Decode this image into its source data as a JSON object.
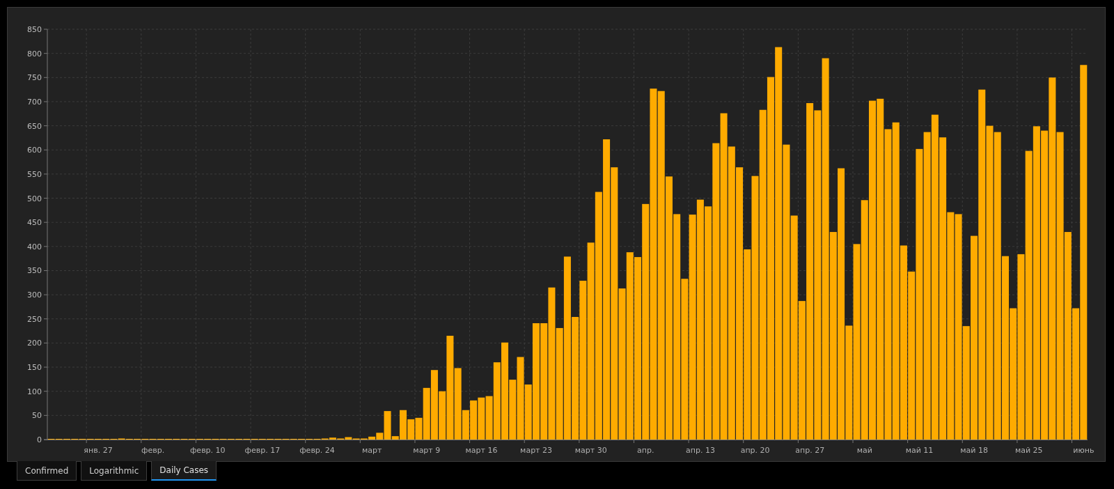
{
  "chart": {
    "chart_data": {
      "type": "bar",
      "categories": [
        null,
        null,
        null,
        null,
        null,
        null,
        "янв. 27",
        null,
        null,
        null,
        null,
        null,
        null,
        "февр.",
        null,
        null,
        null,
        null,
        null,
        null,
        "февр. 10",
        null,
        null,
        null,
        null,
        null,
        null,
        "февр. 17",
        null,
        null,
        null,
        null,
        null,
        null,
        "февр. 24",
        null,
        null,
        null,
        null,
        null,
        null,
        "март",
        null,
        null,
        null,
        null,
        null,
        null,
        "март 9",
        null,
        null,
        null,
        null,
        null,
        null,
        "март 16",
        null,
        null,
        null,
        null,
        null,
        null,
        "март 23",
        null,
        null,
        null,
        null,
        null,
        null,
        "март 30",
        null,
        null,
        null,
        null,
        null,
        null,
        "апр.",
        null,
        null,
        null,
        null,
        null,
        null,
        "апр. 13",
        null,
        null,
        null,
        null,
        null,
        null,
        "апр. 20",
        null,
        null,
        null,
        null,
        null,
        null,
        "апр. 27",
        null,
        null,
        null,
        null,
        null,
        null,
        "май",
        null,
        null,
        null,
        null,
        null,
        null,
        "май 11",
        null,
        null,
        null,
        null,
        null,
        null,
        "май 18",
        null,
        null,
        null,
        null,
        null,
        null,
        "май 25",
        null,
        null,
        null,
        null,
        null,
        null,
        "июнь"
      ],
      "values": [
        0,
        0,
        0,
        0,
        0,
        0,
        0,
        0,
        0,
        2,
        0,
        0,
        0,
        0,
        0,
        0,
        0,
        0,
        0,
        0,
        0,
        0,
        0,
        0,
        0,
        0,
        0,
        0,
        0,
        0,
        0,
        0,
        0,
        0,
        0,
        1,
        4,
        1,
        5,
        2,
        2,
        6,
        14,
        59,
        7,
        61,
        42,
        45,
        107,
        144,
        100,
        215,
        148,
        61,
        81,
        87,
        90,
        160,
        201,
        124,
        171,
        114,
        241,
        241,
        315,
        231,
        379,
        254,
        329,
        408,
        513,
        622,
        564,
        313,
        388,
        378,
        488,
        727,
        722,
        545,
        467,
        333,
        466,
        497,
        483,
        614,
        676,
        607,
        564,
        394,
        546,
        683,
        751,
        813,
        611,
        464,
        287,
        697,
        682,
        790,
        430,
        562,
        236,
        405,
        496,
        702,
        706,
        643,
        657,
        402,
        348,
        602,
        637,
        673,
        626,
        471,
        467,
        235,
        422,
        725,
        650,
        637,
        380,
        272,
        384,
        598,
        649,
        640,
        750,
        637,
        430,
        272,
        776
      ],
      "grid": true,
      "ylim": [
        0,
        850
      ],
      "yticks": [
        0,
        50,
        100,
        150,
        200,
        250,
        300,
        350,
        400,
        450,
        500,
        550,
        600,
        650,
        700,
        750,
        800,
        850
      ]
    }
  },
  "tabs": [
    {
      "label": "Confirmed",
      "selected": false
    },
    {
      "label": "Logarithmic",
      "selected": false
    },
    {
      "label": "Daily Cases",
      "selected": true
    }
  ]
}
